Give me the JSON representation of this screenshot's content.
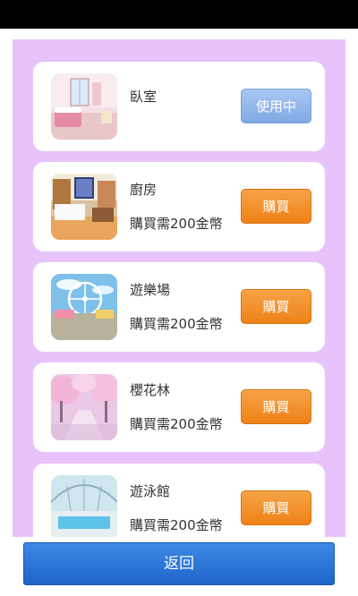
{
  "rooms": [
    {
      "name": "臥室",
      "price": "",
      "button": "使用中",
      "status": "using"
    },
    {
      "name": "廚房",
      "price": "購買需200金幣",
      "button": "購買",
      "status": "buy"
    },
    {
      "name": "遊樂場",
      "price": "購買需200金幣",
      "button": "購買",
      "status": "buy"
    },
    {
      "name": "櫻花林",
      "price": "購買需200金幣",
      "button": "購買",
      "status": "buy"
    },
    {
      "name": "遊泳館",
      "price": "購買需200金幣",
      "button": "購買",
      "status": "buy"
    }
  ],
  "footer": {
    "back_label": "返回"
  },
  "colors": {
    "panel": "#e8c3fb",
    "buy_button": "#f28c28",
    "using_button": "#8fb4ea",
    "back_button": "#2a74d8"
  }
}
